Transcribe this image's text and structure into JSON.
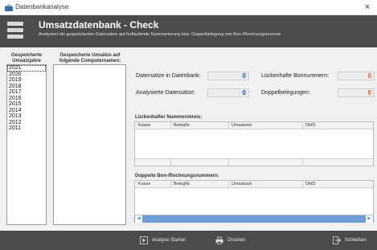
{
  "window": {
    "title": "Datenbankanalyse",
    "close_glyph": "×"
  },
  "header": {
    "title": "Umsatzdatenbank - Check",
    "subtitle": "Analysiert die gespeicherten Datensätze auf fortlaufende Nummerierung bzw. Doppelbelegung von Bon-/Rechnungsnumme"
  },
  "left": {
    "years_label_1": "Gespeicherte",
    "years_label_2": "Umsatzjahre",
    "numbers_label_1": "Gespeicherte Umsätze auf",
    "numbers_label_2": "folgende Computernamen:",
    "years": [
      "2021",
      "2020",
      "2019",
      "2018",
      "2017",
      "2016",
      "2015",
      "2014",
      "2013",
      "2012",
      "2011"
    ],
    "selected_year": "2021"
  },
  "stats": {
    "records_label": "Datensätze in Datenbank:",
    "records_value": "0",
    "analysed_label": "Analysierte Datensätze:",
    "analysed_value": "0",
    "missing_label": "Lückenhafte Bonnummern:",
    "missing_value": "0",
    "duplicates_label": "Doppelbelegungen:",
    "duplicates_value": "0"
  },
  "gaps": {
    "title": "Lückenhafter Nummernkreis:",
    "columns": [
      "Kasse",
      "BelegNr.",
      "Umsatzart",
      "DbID"
    ]
  },
  "dupes": {
    "title": "Doppelte Bon-/Rechnungsnummern:",
    "columns": [
      "Kasse",
      "BelegNr.",
      "Umsatzart",
      "DbID"
    ]
  },
  "footer": {
    "analyse": "Analyse Starten",
    "print": "Drucken",
    "close": "Schließen"
  },
  "colors": {
    "header": "#4b4b4b",
    "value_blue": "#1c4fd8",
    "value_orange": "#e0631b",
    "scrollbar": "#6e9ed8"
  },
  "icons": [
    "database-app-icon",
    "menu-logo-icon",
    "play-icon",
    "printer-icon",
    "exit-icon",
    "close-icon",
    "scroll-left-icon",
    "scroll-right-icon"
  ]
}
